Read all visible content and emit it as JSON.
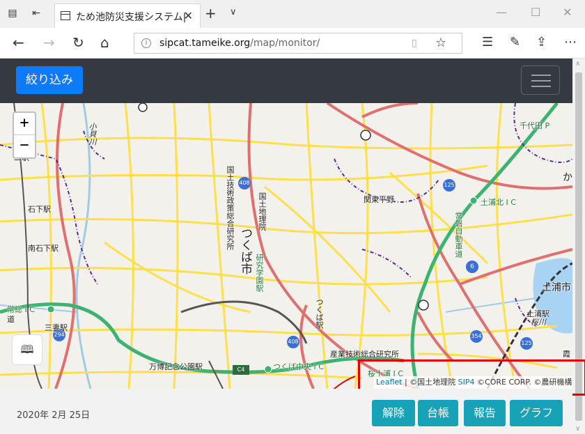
{
  "browser": {
    "tab_title": "ため池防災支援システム|",
    "url_host": "sipcat.tameike.org",
    "url_path": "/map/monitor/"
  },
  "navbar": {
    "filter_label": "絞り込み"
  },
  "map": {
    "zoom_in": "+",
    "zoom_out": "−",
    "labels": {
      "chiyoda": "千代田 P",
      "tsuchiura_north_ic": "土浦北 I C",
      "kanto_plain": "関東平野",
      "joban_expressway": "常磐自動車道",
      "kokudo_gijutsu": "国土技術政策総合研究所",
      "kokudo_chiriin": "国土地理院",
      "tsukuba_city": "つくば市",
      "kenkyu_gakuen": "研究学園駅",
      "tsuchiura_city": "土浦市",
      "tsuchiura_station": "土浦駅",
      "sakuragawa": "桜川",
      "ishige_station": "石下駅",
      "minami_ishige": "南石下駅",
      "mitsumaido": "三妻駅",
      "joso_ic": "常総 I C",
      "tsukuba_station": "つくば駅",
      "sangyo_gijutsu": "産業技術総合研究所",
      "banpaku_station": "万博記念公園駅",
      "tsukuba_chuo_ic": "つくば中央 I C",
      "sakuratsuchiura_ic": "桜土浦 I C",
      "kogai_river": "小貝川",
      "ka": "か",
      "kasumi": "霞",
      "michi": "道",
      "ni_station": "二駅"
    },
    "route_shields": [
      "408",
      "125",
      "6",
      "294",
      "408",
      "354",
      "125"
    ],
    "exp_shield": "C4",
    "attribution": {
      "leaflet": "Leaflet",
      "sep": " | ",
      "gsi": "©国土地理院",
      "sip": "SIP4",
      "core": "©CORE CORP.",
      "naro": "©農研機構"
    }
  },
  "footer": {
    "date": "2020年 2月 25日",
    "buttons": [
      "解除",
      "台帳",
      "報告",
      "グラフ"
    ]
  },
  "colors": {
    "navbar_bg": "#343a40",
    "primary": "#0d7bff",
    "info": "#17a2b8",
    "highlight": "#e00000",
    "expressway": "#3cb371",
    "national_road": "#e07070",
    "prefectural_road": "#ffe04a"
  }
}
